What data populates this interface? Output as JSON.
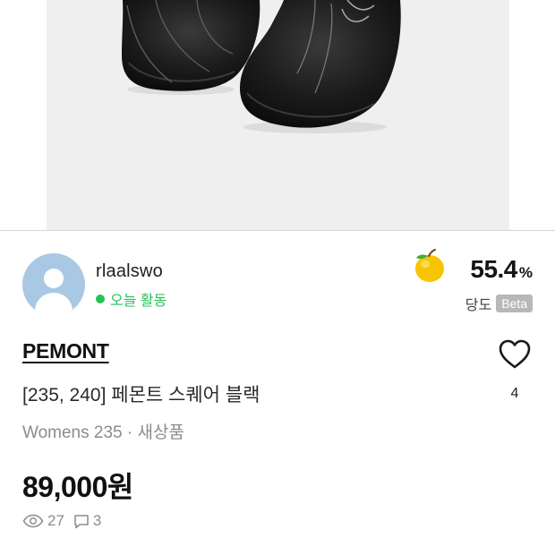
{
  "product_image": {
    "icon": "shoe-photo"
  },
  "seller": {
    "name": "rlaalswo",
    "status_text": "오늘 활동",
    "status_color": "#27c25a"
  },
  "sweetness": {
    "icon": "apple-icon",
    "value": "55.4",
    "unit": "%",
    "label": "당도",
    "badge": "Beta"
  },
  "product": {
    "brand": "PEMONT",
    "title": "[235, 240] 페몬트 스퀘어 블랙",
    "meta": "Womens 235 · 새상품",
    "price": "89,000원",
    "likes": "4"
  },
  "stats": {
    "views": "27",
    "comments": "3"
  }
}
